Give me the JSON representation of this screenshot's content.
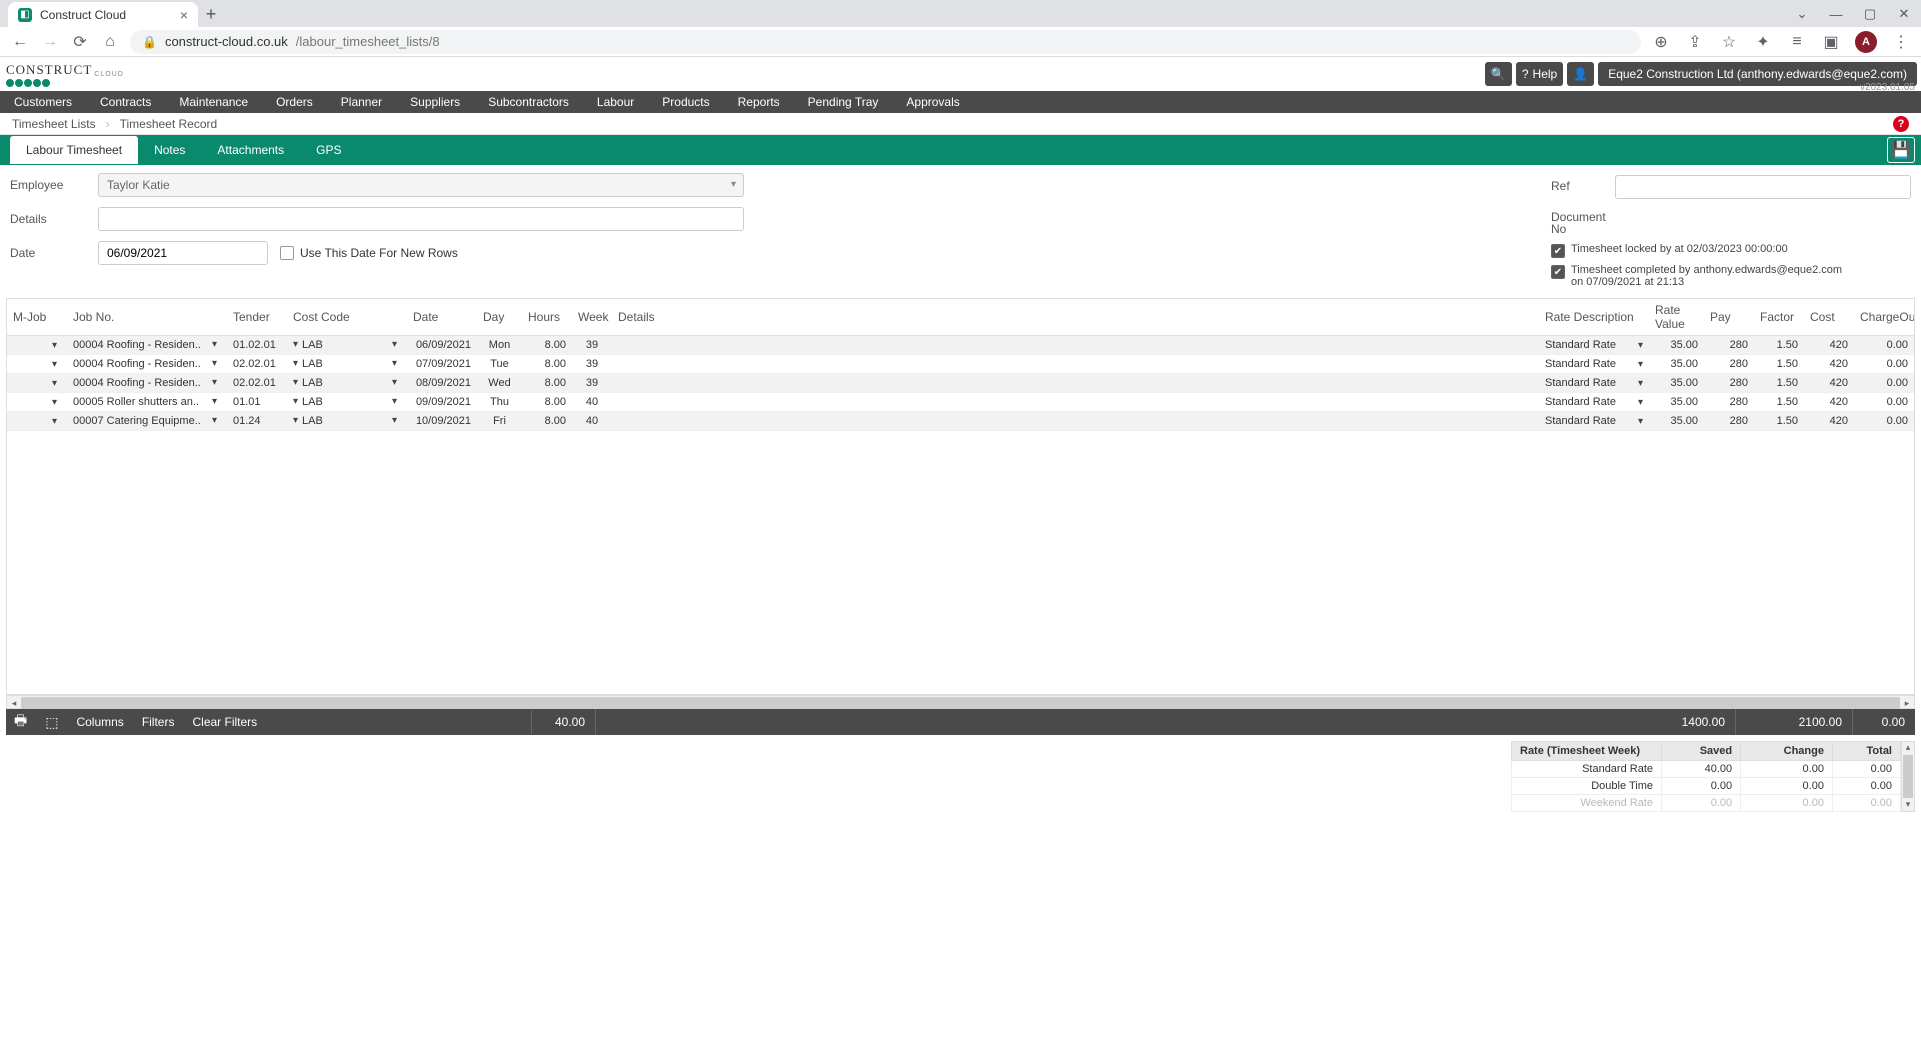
{
  "browser": {
    "tab_title": "Construct Cloud",
    "url_host": "construct-cloud.co.uk",
    "url_path": "/labour_timesheet_lists/8",
    "avatar_letter": "A"
  },
  "header": {
    "logo_top": "CLOUD",
    "logo_main": "CONSTRUCT",
    "help_label": "Help",
    "user_strip": "Eque2 Construction Ltd (anthony.edwards@eque2.com)",
    "version": "v2023.01.05"
  },
  "nav": [
    "Customers",
    "Contracts",
    "Maintenance",
    "Orders",
    "Planner",
    "Suppliers",
    "Subcontractors",
    "Labour",
    "Products",
    "Reports",
    "Pending Tray",
    "Approvals"
  ],
  "breadcrumb": {
    "a": "Timesheet Lists",
    "b": "Timesheet Record"
  },
  "tabs": [
    "Labour Timesheet",
    "Notes",
    "Attachments",
    "GPS"
  ],
  "form": {
    "employee_label": "Employee",
    "employee_value": "Taylor Katie",
    "details_label": "Details",
    "details_value": "",
    "date_label": "Date",
    "date_value": "06/09/2021",
    "use_date_label": "Use This Date For New Rows",
    "ref_label": "Ref",
    "ref_value": "",
    "docno_label": "Document No",
    "docno_value": "",
    "locked_text": "Timesheet locked by at 02/03/2023 00:00:00",
    "completed_text": "Timesheet completed by anthony.edwards@eque2.com on 07/09/2021 at 21:13"
  },
  "grid": {
    "columns": [
      "M-Job",
      "Job No.",
      "Tender",
      "Cost Code",
      "Date",
      "Day",
      "Hours",
      "Week",
      "Details",
      "Rate Description",
      "Rate Value",
      "Pay",
      "Factor",
      "Cost",
      "ChargeOut"
    ],
    "rows": [
      {
        "mjob": "",
        "job": "00004 Roofing - Residen..",
        "tender": "01.02.01",
        "cc": "LAB",
        "date": "06/09/2021",
        "day": "Mon",
        "hours": "8.00",
        "week": "39",
        "details": "",
        "rdesc": "Standard Rate",
        "rval": "35.00",
        "pay": "280",
        "fac": "1.50",
        "cost": "420",
        "out": "0.00"
      },
      {
        "mjob": "",
        "job": "00004 Roofing - Residen..",
        "tender": "02.02.01",
        "cc": "LAB",
        "date": "07/09/2021",
        "day": "Tue",
        "hours": "8.00",
        "week": "39",
        "details": "",
        "rdesc": "Standard Rate",
        "rval": "35.00",
        "pay": "280",
        "fac": "1.50",
        "cost": "420",
        "out": "0.00"
      },
      {
        "mjob": "",
        "job": "00004 Roofing - Residen..",
        "tender": "02.02.01",
        "cc": "LAB",
        "date": "08/09/2021",
        "day": "Wed",
        "hours": "8.00",
        "week": "39",
        "details": "",
        "rdesc": "Standard Rate",
        "rval": "35.00",
        "pay": "280",
        "fac": "1.50",
        "cost": "420",
        "out": "0.00"
      },
      {
        "mjob": "",
        "job": "00005 Roller shutters an..",
        "tender": "01.01",
        "cc": "LAB",
        "date": "09/09/2021",
        "day": "Thu",
        "hours": "8.00",
        "week": "40",
        "details": "",
        "rdesc": "Standard Rate",
        "rval": "35.00",
        "pay": "280",
        "fac": "1.50",
        "cost": "420",
        "out": "0.00"
      },
      {
        "mjob": "",
        "job": "00007 Catering Equipme..",
        "tender": "01.24",
        "cc": "LAB",
        "date": "10/09/2021",
        "day": "Fri",
        "hours": "8.00",
        "week": "40",
        "details": "",
        "rdesc": "Standard Rate",
        "rval": "35.00",
        "pay": "280",
        "fac": "1.50",
        "cost": "420",
        "out": "0.00"
      }
    ],
    "footer": {
      "columns_btn": "Columns",
      "filters_btn": "Filters",
      "clear_filters_btn": "Clear Filters",
      "total_hours": "40.00",
      "total_pay": "1400.00",
      "total_cost": "2100.00",
      "total_charge": "0.00"
    }
  },
  "summary": {
    "headers": [
      "Rate (Timesheet Week)",
      "Saved",
      "Change",
      "Total"
    ],
    "rows": [
      {
        "label": "Standard Rate",
        "saved": "40.00",
        "change": "0.00",
        "total": "0.00"
      },
      {
        "label": "Double Time",
        "saved": "0.00",
        "change": "0.00",
        "total": "0.00"
      },
      {
        "label": "Weekend Rate",
        "saved": "0.00",
        "change": "0.00",
        "total": "0.00"
      }
    ]
  }
}
